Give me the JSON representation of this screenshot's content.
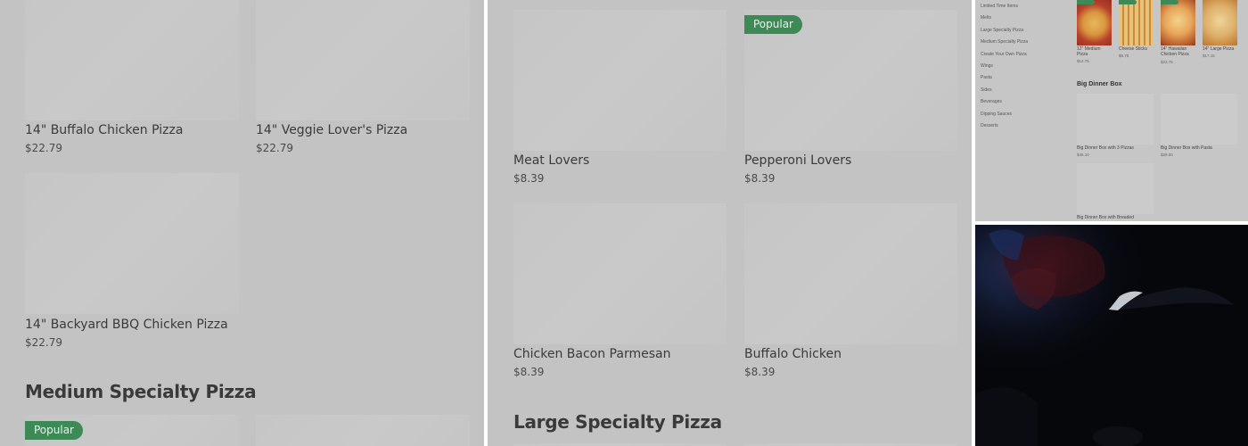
{
  "panel1": {
    "items": [
      {
        "name": "14\" Buffalo Chicken Pizza",
        "price": "$22.79"
      },
      {
        "name": "14\" Veggie Lover's Pizza",
        "price": "$22.79"
      },
      {
        "name": "14\" Backyard BBQ Chicken Pizza",
        "price": "$22.79"
      }
    ],
    "section_title": "Medium Specialty Pizza",
    "badge": "Popular"
  },
  "panel2": {
    "badge": "Popular",
    "items": [
      {
        "name": "Meat Lovers",
        "price": "$8.39"
      },
      {
        "name": "Pepperoni Lovers",
        "price": "$8.39"
      },
      {
        "name": "Chicken Bacon Parmesan",
        "price": "$8.39"
      },
      {
        "name": "Buffalo Chicken",
        "price": "$8.39"
      }
    ],
    "section_title": "Large Specialty Pizza"
  },
  "panel3": {
    "nav": [
      "Limited Time Items",
      "Melts",
      "Large Specialty Pizza",
      "Medium Specialty Pizza",
      "Create Your Own Pizza",
      "Wings",
      "Pasta",
      "Sides",
      "Beverages",
      "Dipping Sauces",
      "Desserts"
    ],
    "top_items": [
      {
        "name": "12\" Medium Pizza",
        "price": "$14.75"
      },
      {
        "name": "Cheese Sticks",
        "price": "$8.75"
      },
      {
        "name": "14\" Hawaiian Chicken Pizza",
        "price": "$22.75"
      },
      {
        "name": "14\" Large Pizza",
        "price": "$17.15"
      }
    ],
    "section_title": "Big Dinner Box",
    "box_items": [
      {
        "name": "Big Dinner Box with 3 Pizzas",
        "price": "$45.10"
      },
      {
        "name": "Big Dinner Box with Pasta",
        "price": "$39.00"
      },
      {
        "name": "Big Dinner Box with Breaded"
      }
    ]
  },
  "colors": {
    "overlay_grey": "#c3c3c3",
    "badge_green": "#3d8a56",
    "dark_photo": "#06070b"
  }
}
